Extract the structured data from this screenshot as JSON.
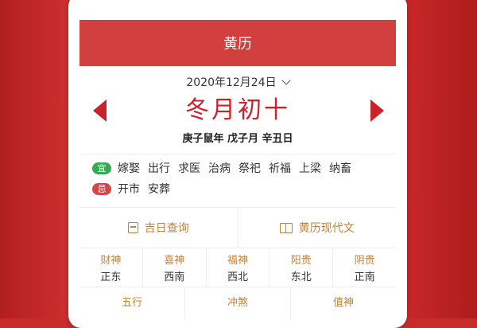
{
  "header": {
    "title": "黄历"
  },
  "date": {
    "gregorian": "2020年12月24日",
    "lunar": "冬月初十",
    "ganzhi": "庚子鼠年 戊子月 辛丑日"
  },
  "yi": {
    "tag": "宜",
    "items": [
      "嫁娶",
      "出行",
      "求医",
      "治病",
      "祭祀",
      "祈福",
      "上梁",
      "纳畜"
    ]
  },
  "ji": {
    "tag": "忌",
    "items": [
      "开市",
      "安葬"
    ]
  },
  "tools": {
    "lucky_day": "吉日查询",
    "modern_text": "黄历现代文"
  },
  "gods": [
    {
      "name": "财神",
      "direction": "正东"
    },
    {
      "name": "喜神",
      "direction": "西南"
    },
    {
      "name": "福神",
      "direction": "西北"
    },
    {
      "name": "阳贵",
      "direction": "东北"
    },
    {
      "name": "阴贵",
      "direction": "正南"
    }
  ],
  "bottom": [
    "五行",
    "冲煞",
    "值神"
  ],
  "colors": {
    "header": "#d23f3f",
    "accent_red": "#c8232b",
    "gold": "#c0823a",
    "good_tag": "#3aa757",
    "bad_tag": "#d64545"
  }
}
